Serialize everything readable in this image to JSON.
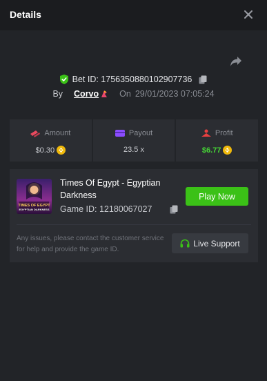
{
  "header": {
    "title": "Details",
    "close_icon": "close-icon"
  },
  "share_icon": "share-icon",
  "bet": {
    "id_label": "Bet ID: 1756350880102907736",
    "by_label": "By",
    "username": "Corvo",
    "on_label": "On",
    "timestamp": "29/01/2023 07:05:24",
    "verified_icon": "shield-check-icon",
    "copy_icon": "copy-icon"
  },
  "stats": {
    "amount": {
      "label": "Amount",
      "value": "$0.30",
      "icon": "amount-icon",
      "color": "#e84a5f"
    },
    "payout": {
      "label": "Payout",
      "value": "23.5 x",
      "icon": "payout-icon",
      "color": "#8b4cff"
    },
    "profit": {
      "label": "Profit",
      "value": "$6.77",
      "icon": "profit-icon",
      "color": "#e84040"
    }
  },
  "game": {
    "title": "Times Of Egypt - Egyptian Darkness",
    "id_label": "Game ID: 12180067027",
    "thumb_text_1": "TIMES OF EGYPT",
    "thumb_text_2": "EGYPTIAN DARKNESS",
    "play_label": "Play Now",
    "notice": "Any issues, please contact the customer service for help and provide the game ID.",
    "support_label": "Live Support",
    "support_icon": "headset-icon"
  },
  "colors": {
    "accent_green": "#3bc117",
    "profit_green": "#46d436",
    "background": "#222428",
    "card": "#2b2d32"
  }
}
